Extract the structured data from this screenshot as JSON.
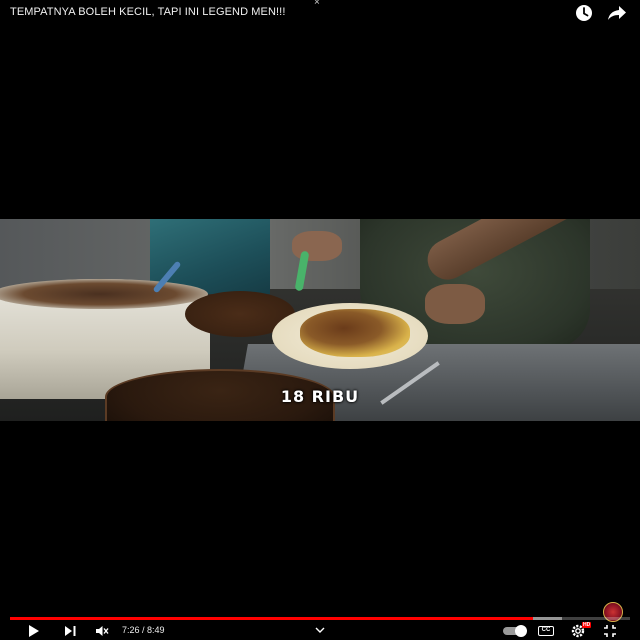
{
  "video": {
    "title": "TEMPATNYA BOLEH KECIL, TAPI INI LEGEND MEN!!!",
    "caption": "18 RIBU"
  },
  "top_bar": {
    "close_glyph": "×",
    "icons": [
      "watch-later-icon",
      "share-icon"
    ]
  },
  "controls": {
    "time_display": "7:26 / 8:49",
    "cc_label": "CC",
    "quality_badge": "HD",
    "played_fraction": 0.843,
    "loaded_fraction": 0.89,
    "autoplay_on": true,
    "icons": [
      "play-icon",
      "next-icon",
      "mute-icon",
      "chevron-up-icon",
      "autoplay-toggle",
      "captions-icon",
      "settings-icon",
      "exit-fullscreen-icon"
    ]
  },
  "colors": {
    "progress_played": "#ff0000",
    "background": "#000000",
    "caption_text": "#ffffff"
  }
}
